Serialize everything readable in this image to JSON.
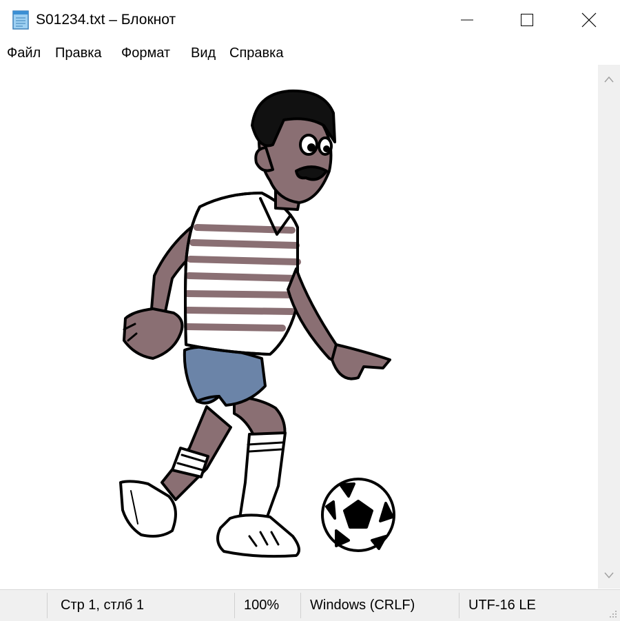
{
  "window": {
    "title": "S01234.txt – Блокнот",
    "icon": "notepad-icon",
    "controls": {
      "minimize": "minimize-icon",
      "maximize": "maximize-icon",
      "close": "close-icon"
    }
  },
  "menu": {
    "items": [
      "Файл",
      "Правка",
      "Формат",
      "Вид",
      "Справка"
    ]
  },
  "document": {
    "illustration": "soccer-player-kicking-ball",
    "colors": {
      "skin": "#8a6f73",
      "shorts": "#6b84a8",
      "outline": "#000000",
      "background": "#ffffff"
    }
  },
  "status": {
    "position": "Стр 1, стлб 1",
    "zoom": "100%",
    "line_endings": "Windows (CRLF)",
    "encoding": "UTF-16 LE"
  },
  "colors": {
    "chrome": "#ffffff",
    "statusbar": "#f0f0f0",
    "scrollbar": "#f0f0f0"
  }
}
